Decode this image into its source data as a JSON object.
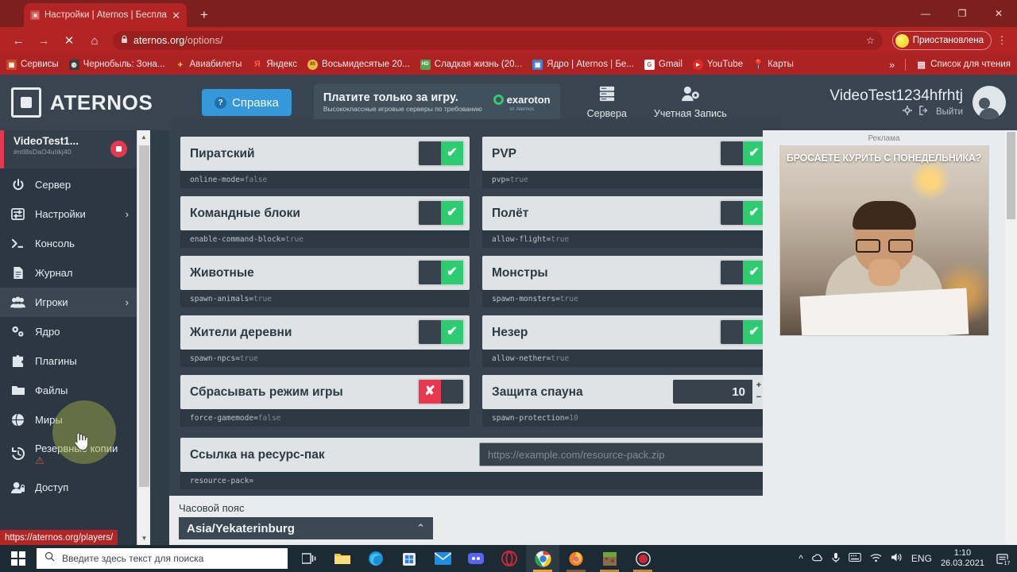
{
  "browser": {
    "tab": {
      "title": "Настройки | Aternos | Бесплатн",
      "close_label": "✕",
      "favicon": "aternos-favicon"
    },
    "new_tab_label": "+",
    "window_controls": {
      "minimize": "—",
      "maximize": "❐",
      "close": "✕"
    },
    "nav": {
      "back": "←",
      "forward": "→",
      "stop": "✕",
      "home": "⌂"
    },
    "omnibox": {
      "lock": "🔒",
      "domain": "aternos.org",
      "path": "/options/",
      "star": "☆"
    },
    "profile": {
      "label": "Приостановлена"
    },
    "menu_label": "⋮",
    "bookmarks": [
      {
        "label": "Сервисы",
        "icon": "apps-grid-icon",
        "color": "#e8a33d"
      },
      {
        "label": "Чернобыль: Зона...",
        "icon": "site-icon",
        "color": "#3b3b3b"
      },
      {
        "label": "Авиабилеты",
        "icon": "plane-icon",
        "color": "#e8c33d"
      },
      {
        "label": "Яндекс",
        "icon": "yandex-icon",
        "color": "#c93a3a"
      },
      {
        "label": "Восьмидесятые 20...",
        "icon": "site-icon",
        "color": "#e8b93d"
      },
      {
        "label": "Сладкая жизнь (20...",
        "icon": "hd-icon",
        "color": "#4aa84a"
      },
      {
        "label": "Ядро | Aternos | Бе...",
        "icon": "aternos-icon",
        "color": "#4a7fc1"
      },
      {
        "label": "Gmail",
        "icon": "gmail-icon",
        "color": "#ffffff"
      },
      {
        "label": "YouTube",
        "icon": "youtube-icon",
        "color": "#e02a2a"
      },
      {
        "label": "Карты",
        "icon": "maps-pin-icon",
        "color": "#e8c33d"
      }
    ],
    "bookmarks_overflow": "»",
    "reading_list": "Список для чтения",
    "status_url": "https://aternos.org/players/"
  },
  "site_header": {
    "brand": "ATERNOS",
    "help_button": "Справка",
    "promo": {
      "line1": "Платите только за игру.",
      "line2": "Высококлассные игровые серверы по требованию",
      "brand_name": "exaroton",
      "brand_sub": "от Aternos"
    },
    "nav": [
      {
        "label": "Сервера",
        "icon": "server-rack-icon"
      },
      {
        "label": "Учетная Запись",
        "icon": "user-gear-icon"
      }
    ],
    "user": {
      "name": "VideoTest1234hfrhtj",
      "settings_icon": "gear-icon",
      "logout_label": "Выйти"
    }
  },
  "sidebar": {
    "server": {
      "name": "VideoTest1...",
      "id": "#ntl8sDaO4utikj40",
      "stop_icon": "stop-icon"
    },
    "items": [
      {
        "label": "Сервер",
        "icon": "power-icon",
        "chevron": "",
        "active": false
      },
      {
        "label": "Настройки",
        "icon": "sliders-icon",
        "chevron": "›",
        "active": false
      },
      {
        "label": "Консоль",
        "icon": "terminal-icon",
        "chevron": "",
        "active": false
      },
      {
        "label": "Журнал",
        "icon": "document-icon",
        "chevron": "",
        "active": false
      },
      {
        "label": "Игроки",
        "icon": "users-icon",
        "chevron": "›",
        "active": true
      },
      {
        "label": "Ядро",
        "icon": "cogs-icon",
        "chevron": "",
        "active": false
      },
      {
        "label": "Плагины",
        "icon": "puzzle-icon",
        "chevron": "",
        "active": false
      },
      {
        "label": "Файлы",
        "icon": "folder-icon",
        "chevron": "",
        "active": false
      },
      {
        "label": "Миры",
        "icon": "globe-icon",
        "chevron": "",
        "active": false
      },
      {
        "label": "Резервные копии",
        "icon": "history-icon",
        "chevron": "",
        "active": false,
        "warning": "⚠"
      },
      {
        "label": "Доступ",
        "icon": "user-lock-icon",
        "chevron": "",
        "active": false
      }
    ]
  },
  "settings": {
    "left_column": [
      {
        "title": "Пиратский",
        "key": "online-mode=",
        "value": "false",
        "control": "toggle",
        "state": "on"
      },
      {
        "title": "Командные блоки",
        "key": "enable-command-block=",
        "value": "true",
        "control": "toggle",
        "state": "on"
      },
      {
        "title": "Животные",
        "key": "spawn-animals=",
        "value": "true",
        "control": "toggle",
        "state": "on"
      },
      {
        "title": "Жители деревни",
        "key": "spawn-npcs=",
        "value": "true",
        "control": "toggle",
        "state": "on"
      },
      {
        "title": "Сбрасывать режим игры",
        "key": "force-gamemode=",
        "value": "false",
        "control": "toggle",
        "state": "off"
      }
    ],
    "right_column": [
      {
        "title": "PVP",
        "key": "pvp=",
        "value": "true",
        "control": "toggle",
        "state": "on"
      },
      {
        "title": "Полёт",
        "key": "allow-flight=",
        "value": "true",
        "control": "toggle",
        "state": "on"
      },
      {
        "title": "Монстры",
        "key": "spawn-monsters=",
        "value": "true",
        "control": "toggle",
        "state": "on"
      },
      {
        "title": "Незер",
        "key": "allow-nether=",
        "value": "true",
        "control": "toggle",
        "state": "on"
      },
      {
        "title": "Защита спауна",
        "key": "spawn-protection=",
        "value": "10",
        "control": "number",
        "number_value": "10",
        "plus": "+",
        "minus": "−"
      }
    ],
    "wide": {
      "title": "Ссылка на ресурс-пак",
      "key": "resource-pack=",
      "value": "",
      "placeholder": "https://example.com/resource-pack.zip"
    },
    "toggle_on_mark": "✔",
    "toggle_off_mark": "✘",
    "timezone": {
      "label": "Часовой пояс",
      "value": "Asia/Yekaterinburg",
      "chevron": "⌃"
    }
  },
  "ad": {
    "label": "Реклама",
    "headline": "БРОСАЕТЕ КУРИТЬ С ПОНЕДЕЛЬНИКА?"
  },
  "taskbar": {
    "start_icon": "windows-start-icon",
    "search_placeholder": "Введите здесь текст для поиска",
    "search_icon": "search-icon",
    "apps": [
      {
        "name": "task-view-icon"
      },
      {
        "name": "file-explorer-icon"
      },
      {
        "name": "microsoft-edge-icon"
      },
      {
        "name": "microsoft-store-icon"
      },
      {
        "name": "mail-icon"
      },
      {
        "name": "discord-icon"
      },
      {
        "name": "opera-icon"
      },
      {
        "name": "google-chrome-icon"
      },
      {
        "name": "firefox-icon"
      },
      {
        "name": "minecraft-icon"
      },
      {
        "name": "recorder-icon"
      }
    ],
    "tray": {
      "chevron": "^",
      "language": "ENG",
      "time": "1:10",
      "date": "26.03.2021",
      "notification_count": "17"
    }
  }
}
